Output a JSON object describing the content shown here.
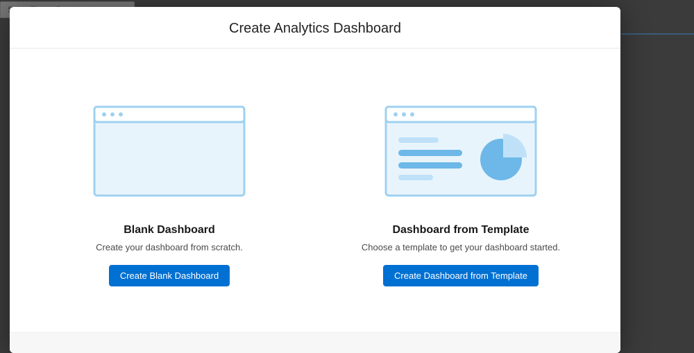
{
  "background": {
    "tab_label": "Sales Target Dashboard"
  },
  "modal": {
    "title": "Create Analytics Dashboard",
    "options": [
      {
        "title": "Blank Dashboard",
        "description": "Create your dashboard from scratch.",
        "button": "Create Blank Dashboard"
      },
      {
        "title": "Dashboard from Template",
        "description": "Choose a template to get your dashboard started.",
        "button": "Create Dashboard from Template"
      }
    ]
  },
  "colors": {
    "primary": "#0070d2",
    "illus_stroke": "#9fd1f0",
    "illus_fill_light": "#e8f4fc",
    "illus_bar_light": "#bfe1f8",
    "illus_bar_dark": "#6db8e8"
  }
}
